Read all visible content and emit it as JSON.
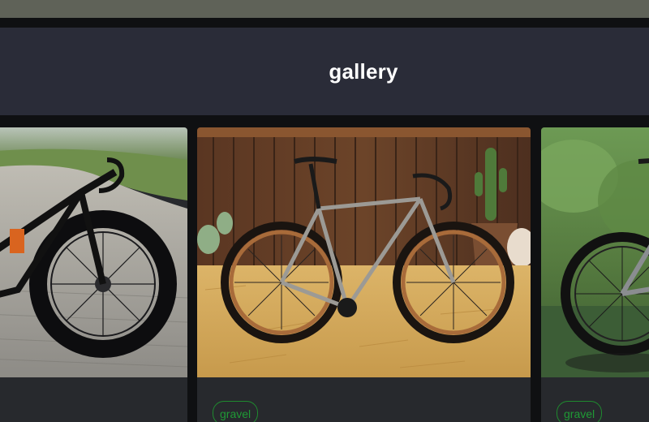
{
  "header": {
    "title": "gallery"
  },
  "gallery": {
    "cards": [
      {
        "tag": "",
        "image": "road bike with deep carbon wheels on cobblestones"
      },
      {
        "tag": "gravel",
        "image": "titanium gravel bike on straw in front of wooden fence with cacti"
      },
      {
        "tag": "gravel",
        "image": "bike with KNIGHT carbon wheels by water"
      }
    ]
  },
  "colors": {
    "header_bg": "#2a2c38",
    "page_bg": "#0f1012",
    "card_bg": "#27292d",
    "tag_green": "#1f9a35"
  }
}
